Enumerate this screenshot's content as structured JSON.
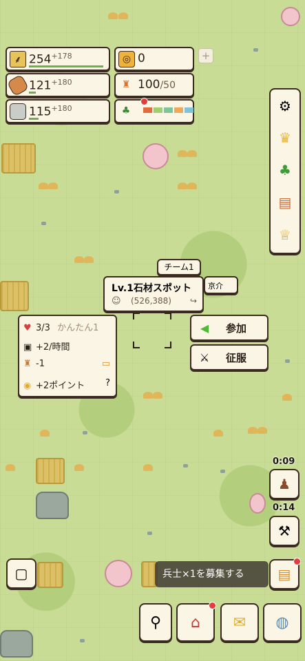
{
  "resources": {
    "wheat": {
      "value": "254",
      "bonus": "+178",
      "icon": "wheat-icon"
    },
    "wood": {
      "value": "121",
      "bonus": "+180",
      "icon": "log-icon"
    },
    "stone": {
      "value": "115",
      "bonus": "+180",
      "icon": "stone-icon"
    },
    "coin": {
      "value": "0",
      "icon": "coin-icon"
    },
    "army": {
      "value": "100",
      "max": "/50",
      "icon": "soldier-icon"
    },
    "plant": {
      "icon": "potted-plant-icon"
    }
  },
  "plus_label": "+",
  "right_menu": [
    "settings-icon",
    "hero-bust-icon",
    "cactus-icon",
    "scroll-icon",
    "trophy-icon"
  ],
  "map": {
    "team_label": "チーム1",
    "spot": {
      "title": "Lv.1石材スポット",
      "coords": "(526,388)"
    },
    "player_name": "京介"
  },
  "actions": {
    "join": "参加",
    "conquer": "征服"
  },
  "info": {
    "hearts": "3/3",
    "difficulty": "かんたん1",
    "production": "+2/時間",
    "troops": "-1",
    "points": "+2ポイント"
  },
  "timers": {
    "recruit": "0:09",
    "forge": "0:14"
  },
  "toast": "兵士×1を募集する",
  "bottom_bar": [
    "map-icon",
    "shop-icon",
    "mail-icon",
    "chat-icon"
  ],
  "colors": {
    "accent_green": "#6bb04a",
    "panel_bg": "#fbf5e6",
    "outline": "#3a2a20",
    "notification_red": "#e43c3c",
    "join_arrow_green": "#52b83a"
  }
}
